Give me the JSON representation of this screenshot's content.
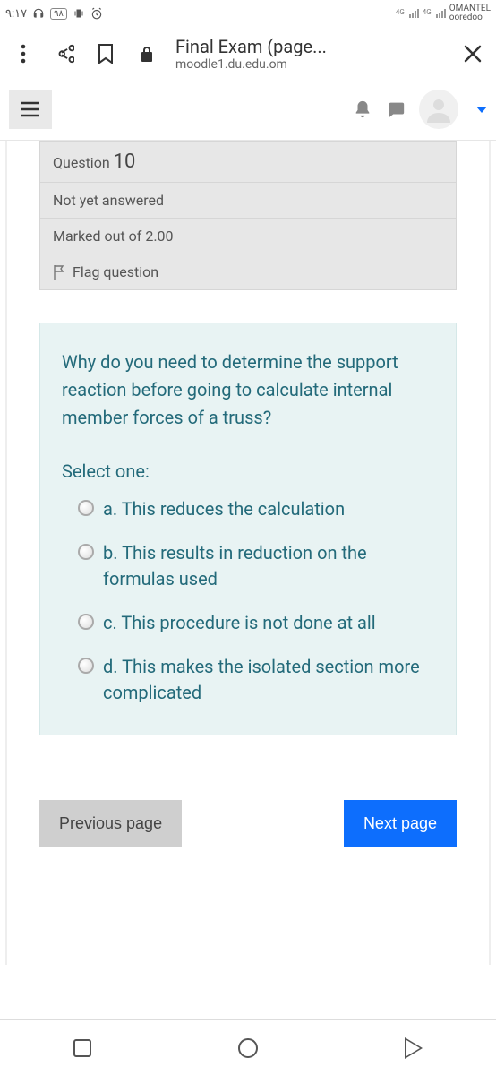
{
  "status": {
    "time": "٩:١٧",
    "battery_badge": "٩٨",
    "sim_label_1": "4G",
    "sim_label_2": "4G",
    "carrier_1": "OMANTEL",
    "carrier_2": "ooredoo"
  },
  "browser": {
    "title": "Final Exam (page...",
    "subtitle": "moodle1.du.edu.om"
  },
  "question_info": {
    "label": "Question",
    "number": "10",
    "status": "Not yet answered",
    "marks": "Marked out of 2.00",
    "flag": "Flag question"
  },
  "question": {
    "text": "Why do you need to determine the support reaction before going to calculate internal member forces of a truss?",
    "select_label": "Select one:",
    "options": {
      "a": "a. This reduces the calculation",
      "b": "b. This results in reduction on the formulas used",
      "c": "c. This procedure is not done at all",
      "d": "d. This makes the isolated section more complicated"
    }
  },
  "nav": {
    "prev": "Previous page",
    "next": "Next page"
  }
}
